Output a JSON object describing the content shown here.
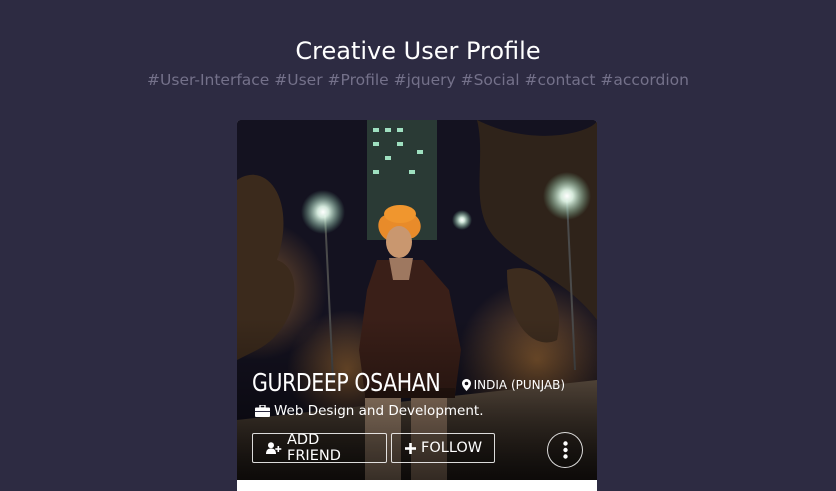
{
  "header": {
    "title": "Creative User Profile",
    "tags": "#User-Interface #User #Profile #jquery #Social #contact #accordion"
  },
  "profile": {
    "name": "GURDEEP OSAHAN",
    "location": "INDIA (PUNJAB)",
    "occupation": "Web Design and Development.",
    "add_friend_label": "ADD FRIEND",
    "follow_label": "FOLLOW"
  },
  "icons": {
    "location": "map-marker-icon",
    "occupation": "briefcase-icon",
    "add_friend": "user-plus-icon",
    "follow": "plus-icon",
    "more": "ellipsis-vertical-icon"
  },
  "colors": {
    "background": "#2d2b42",
    "title": "#ffffff",
    "tags": "#74718a",
    "card": "#ffffff"
  }
}
